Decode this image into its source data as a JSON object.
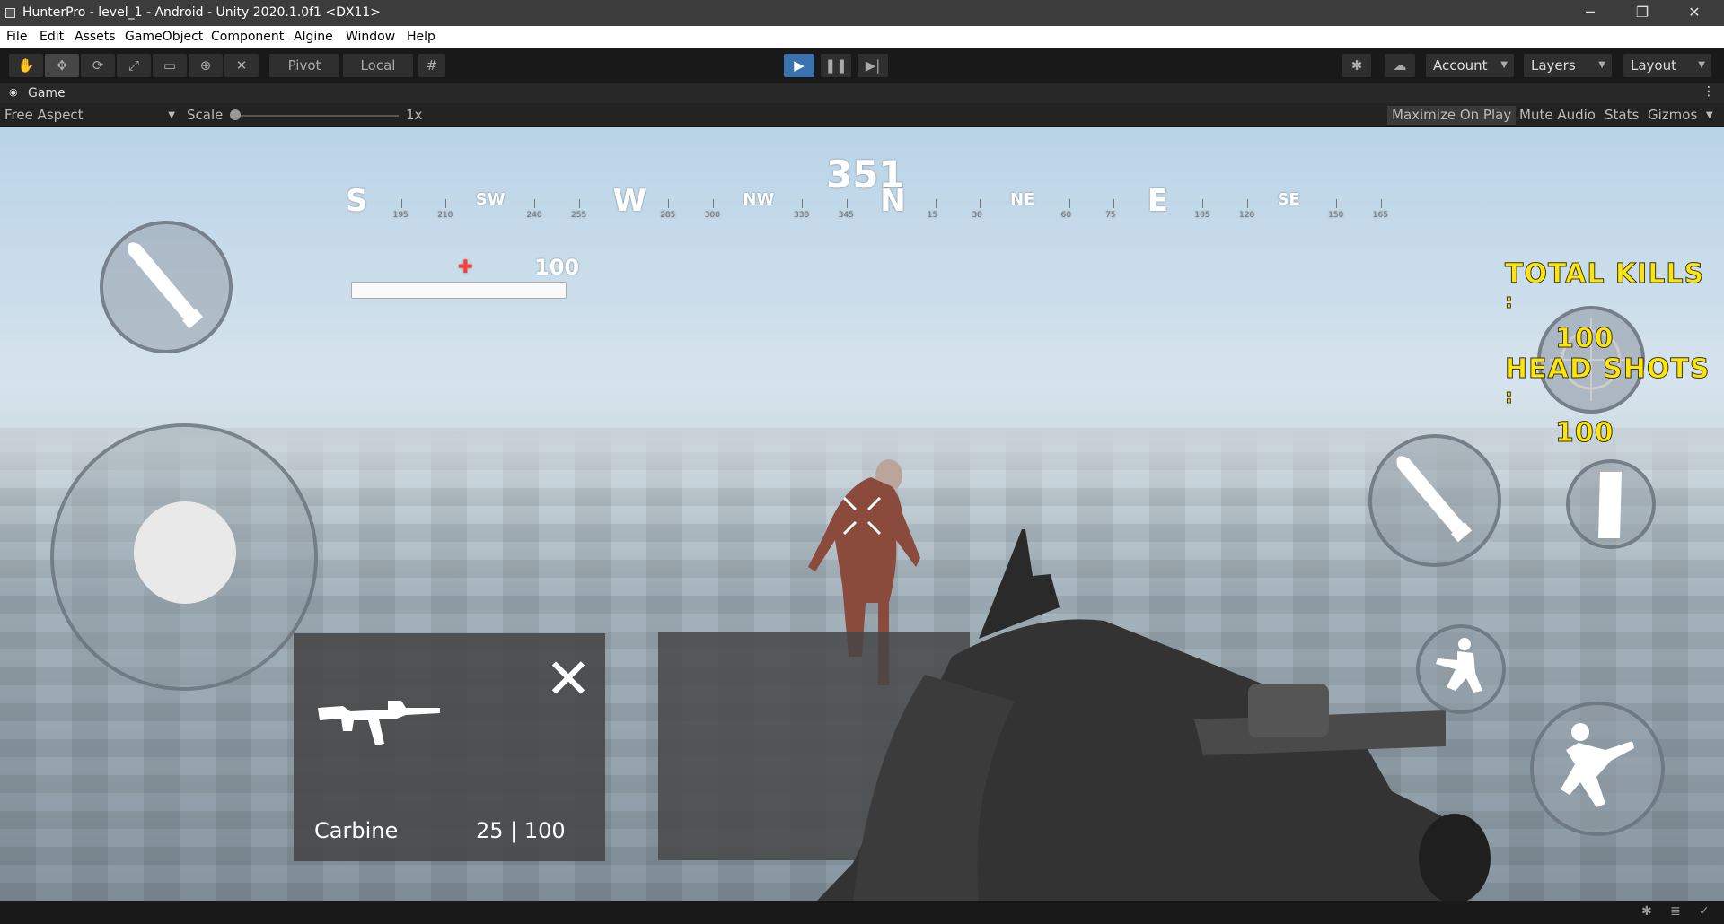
{
  "window": {
    "title": "HunterPro - level_1 - Android - Unity 2020.1.0f1 <DX11>",
    "minimize": "─",
    "maximize": "❐",
    "close": "✕"
  },
  "menu": [
    "File",
    "Edit",
    "Assets",
    "GameObject",
    "Component",
    "Algine",
    "Window",
    "Help"
  ],
  "toolbar": {
    "pivot_label": "Pivot",
    "local_label": "Local",
    "account_label": "Account",
    "layers_label": "Layers",
    "layout_label": "Layout"
  },
  "game_tab": {
    "label": "Game"
  },
  "game_controls": {
    "aspect": "Free Aspect",
    "scale_label": "Scale",
    "scale_value": "1x",
    "maximize_on_play": "Maximize On Play",
    "mute_audio": "Mute Audio",
    "stats": "Stats",
    "gizmos": "Gizmos"
  },
  "hud": {
    "heading": "351",
    "compass": {
      "cardinals": [
        "S",
        "SW",
        "W",
        "NW",
        "N",
        "NE",
        "E",
        "SE"
      ],
      "numbers": [
        "195",
        "210",
        "240",
        "255",
        "285",
        "300",
        "330",
        "345",
        "15",
        "30",
        "60",
        "75",
        "105",
        "120",
        "150",
        "165"
      ]
    },
    "health_value": "100",
    "health_fraction": 1.0,
    "total_kills_label": "TOTAL  KILLS",
    "total_kills_colon": ":",
    "total_kills_value": "100",
    "head_shots_label": "HEAD  SHOTS",
    "head_shots_colon": ":",
    "head_shots_value": "100",
    "weapon_name": "Carbine",
    "ammo": "25 | 100",
    "close_glyph": "✕"
  }
}
